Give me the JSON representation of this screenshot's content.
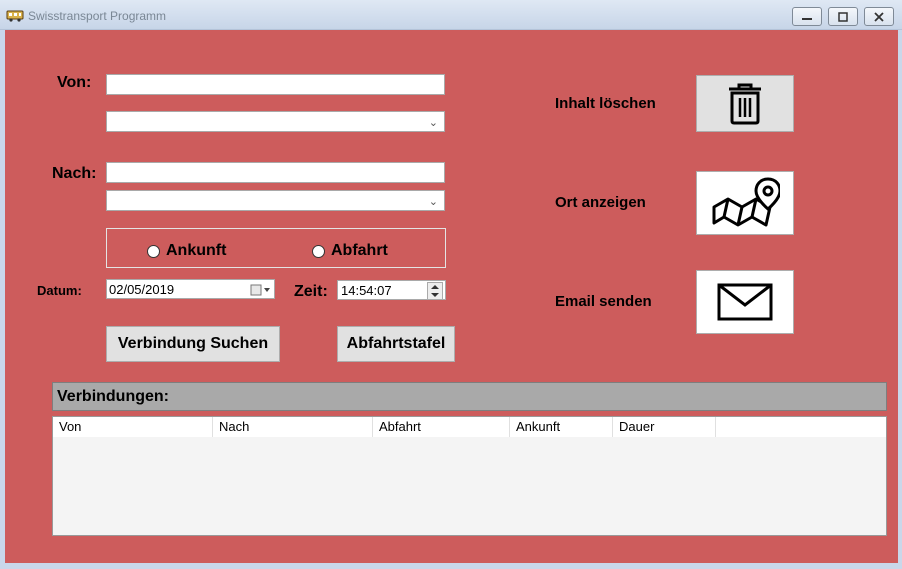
{
  "window": {
    "title": "Swisstransport Programm"
  },
  "form": {
    "von_label": "Von:",
    "nach_label": "Nach:",
    "von_value": "",
    "nach_value": "",
    "radio_ankunft": "Ankunft",
    "radio_abfahrt": "Abfahrt",
    "datum_label": "Datum:",
    "datum_value": "02/05/2019",
    "zeit_label": "Zeit:",
    "zeit_value": "14:54:07",
    "search_button": "Verbindung Suchen",
    "board_button": "Abfahrtstafel"
  },
  "actions": {
    "clear_label": "Inhalt löschen",
    "map_label": "Ort anzeigen",
    "email_label": "Email senden",
    "clear_icon": "trash-icon",
    "map_icon": "map-pin-icon",
    "email_icon": "envelope-icon"
  },
  "connections": {
    "title": "Verbindungen:",
    "columns": [
      "Von",
      "Nach",
      "Abfahrt",
      "Ankunft",
      "Dauer"
    ]
  },
  "colors": {
    "background": "#cd5c5c"
  }
}
